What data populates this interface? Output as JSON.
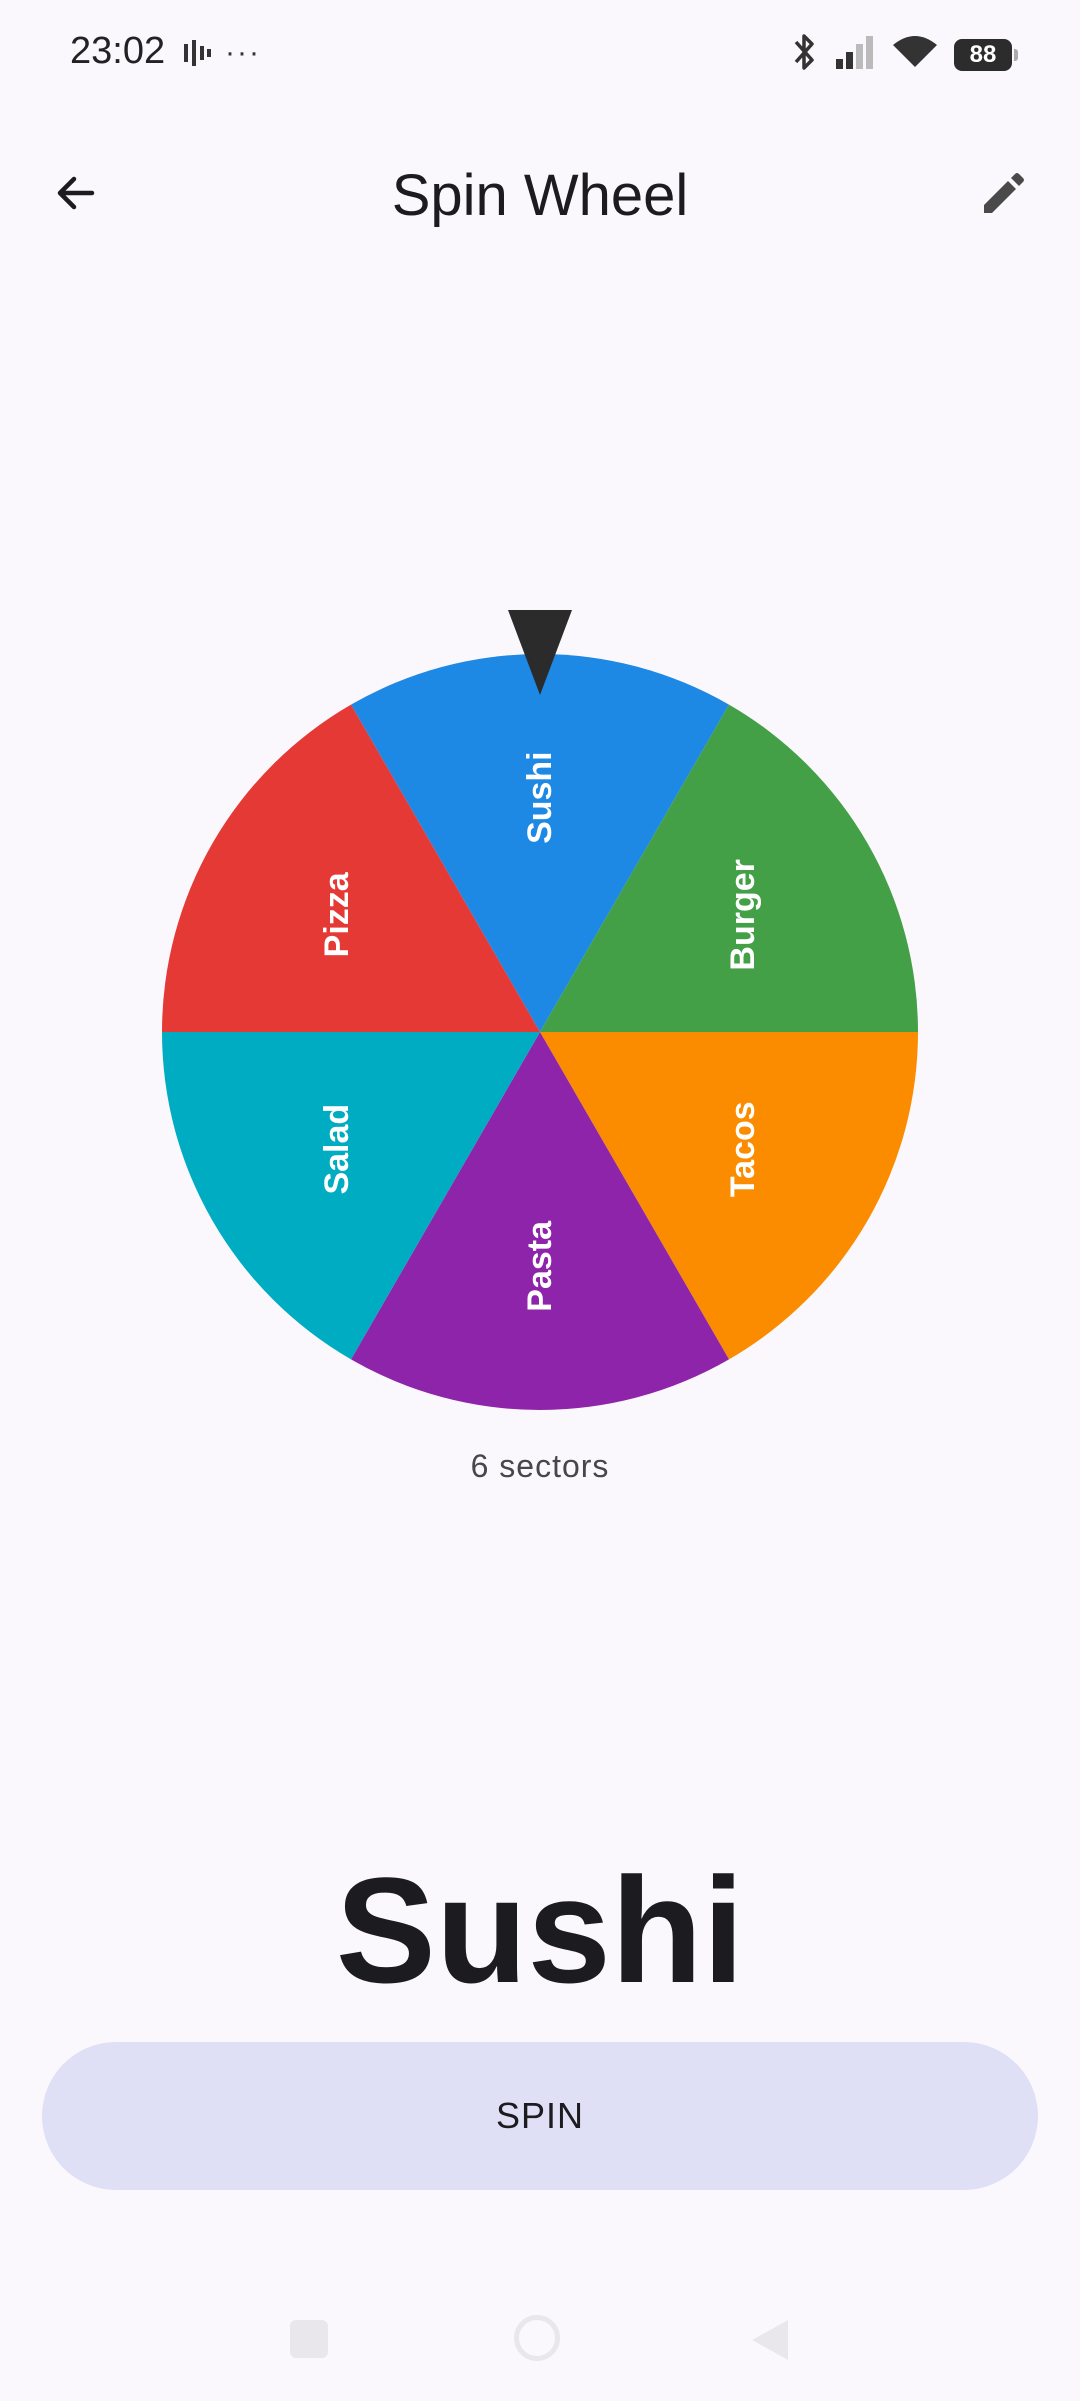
{
  "status_bar": {
    "time": "23:02",
    "notification_icon": "audio-levels-icon",
    "more_icon": "more-dots-icon",
    "battery_level": "88"
  },
  "app_bar": {
    "title": "Spin Wheel",
    "back_icon": "arrow-back-icon",
    "edit_icon": "pencil-edit-icon"
  },
  "wheel": {
    "sectors": [
      {
        "label": "Sushi",
        "color": "#1e88e5"
      },
      {
        "label": "Burger",
        "color": "#43a047"
      },
      {
        "label": "Tacos",
        "color": "#fb8c00"
      },
      {
        "label": "Pasta",
        "color": "#8e24aa"
      },
      {
        "label": "Salad",
        "color": "#00acc1"
      },
      {
        "label": "Pizza",
        "color": "#e53935"
      }
    ],
    "pointer_color": "#2b2b2b",
    "sector_count_text": "6 sectors"
  },
  "result": {
    "text": "Sushi"
  },
  "spin_button": {
    "label": "SPIN"
  }
}
